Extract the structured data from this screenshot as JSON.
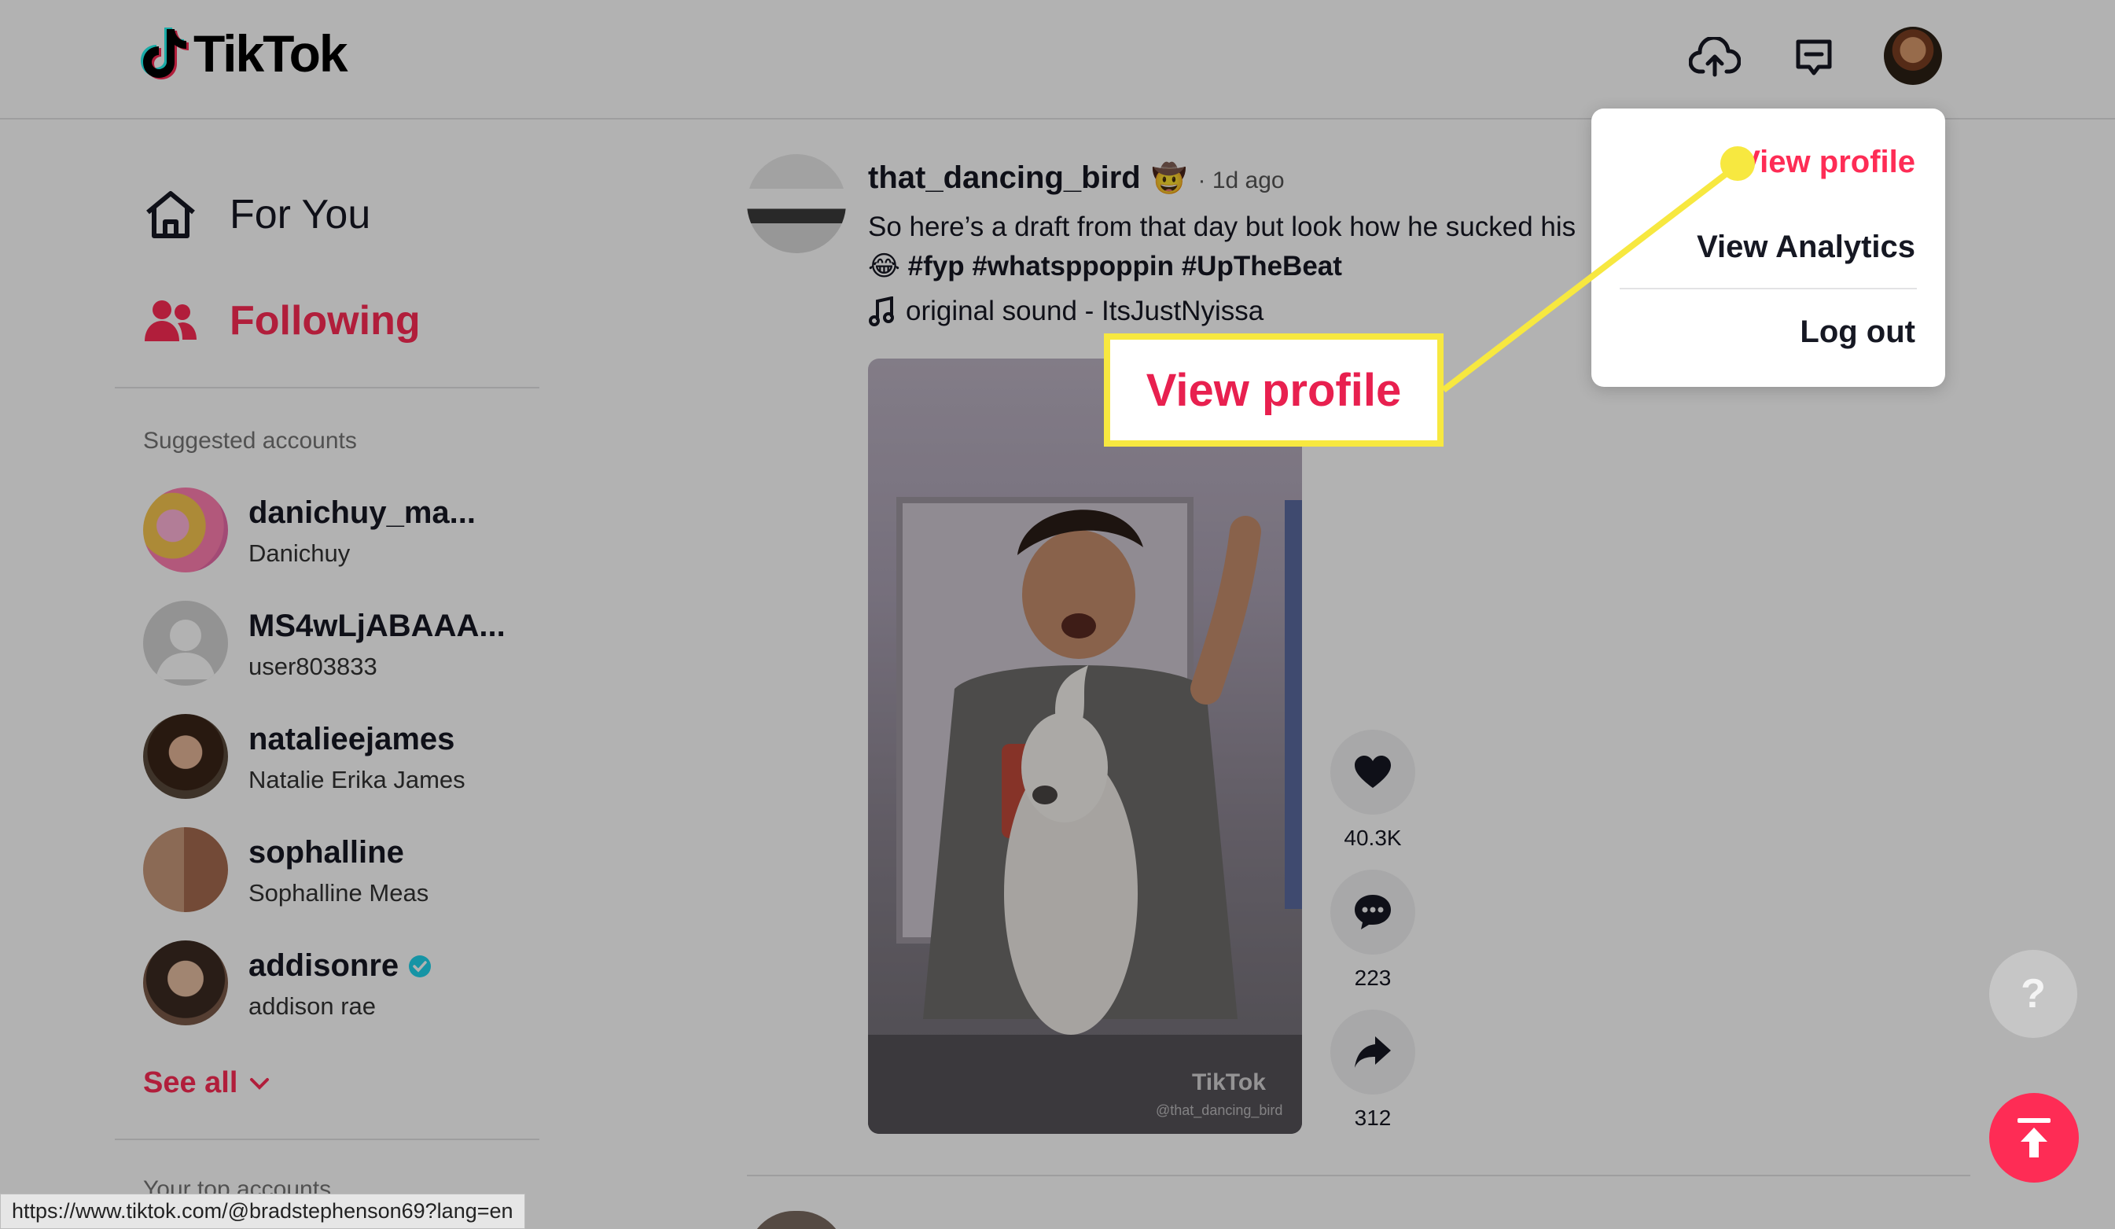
{
  "app": {
    "logo_text": "TikTok"
  },
  "nav": {
    "for_you": "For You",
    "following": "Following"
  },
  "sidebar": {
    "suggested_title": "Suggested accounts",
    "accounts": [
      {
        "username": "danichuy_ma...",
        "name": "Danichuy"
      },
      {
        "username": "MS4wLjABAAA...",
        "name": "user803833"
      },
      {
        "username": "natalieejames",
        "name": "Natalie Erika James"
      },
      {
        "username": "sophalline",
        "name": "Sophalline Meas"
      },
      {
        "username": "addisonre",
        "name": "addison rae",
        "verified": true
      }
    ],
    "see_all": "See all",
    "top_accounts_title": "Your top accounts"
  },
  "post": {
    "username": "that_dancing_bird",
    "emoji": "🤠",
    "time": "· 1d ago",
    "caption": "So here’s a draft from that day but look how he sucked his",
    "caption_emoji": "😂",
    "hashtags": "#fyp #whatsppoppin #UpTheBeat",
    "sound": "original sound - ItsJustNyissa",
    "watermark": "TikTok",
    "watermark_user": "@that_dancing_bird",
    "likes": "40.3K",
    "comments": "223",
    "shares": "312"
  },
  "menu": {
    "view_profile": "View profile",
    "view_analytics": "View Analytics",
    "log_out": "Log out"
  },
  "callout": {
    "text": "View profile"
  },
  "help": {
    "label": "?"
  },
  "status_url": "https://www.tiktok.com/@bradstephenson69?lang=en",
  "colors": {
    "accent": "#fe2c55",
    "callout_yellow": "#f7e840"
  }
}
